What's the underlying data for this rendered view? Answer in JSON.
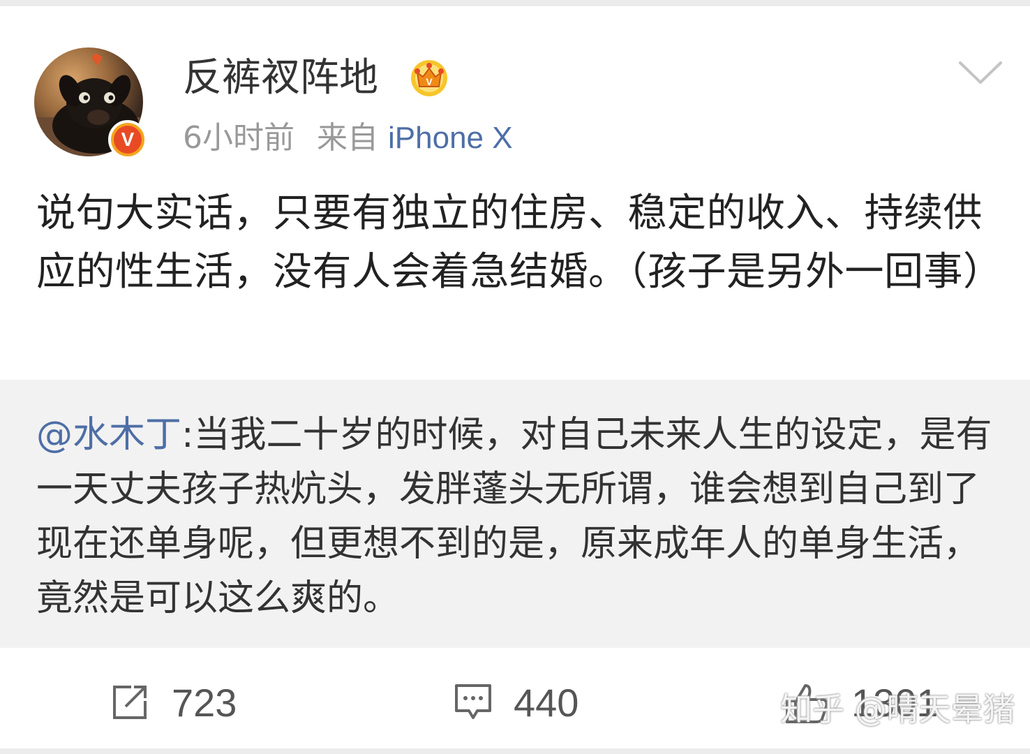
{
  "post": {
    "author": {
      "name": "反裤衩阵地",
      "verified_badge": "V",
      "avatar_icon": "puppy-avatar",
      "member_icon": "crown-icon"
    },
    "time": "6小时前",
    "source_label": "来自",
    "device": "iPhone X",
    "text": "说句大实话，只要有独立的住房、稳定的收入、持续供应的性生活，没有人会着急结婚。（孩子是另外一回事）"
  },
  "repost": {
    "mention": "@水木丁",
    "text": ":当我二十岁的时候，对自己未来人生的设定，是有一天丈夫孩子热炕头，发胖蓬头无所谓，谁会想到自己到了现在还单身呢，但更想不到的是，原来成年人的单身生活，竟然是可以这么爽的。"
  },
  "actions": {
    "repost_count": "723",
    "comment_count": "440",
    "like_count": "1301"
  },
  "watermark": "知乎 @晴天晕猪",
  "colors": {
    "link": "#4e6ea6",
    "meta": "#999999",
    "repost_bg": "#f2f2f2",
    "badge_orange": "#f4a51c",
    "badge_red": "#e84b24"
  }
}
